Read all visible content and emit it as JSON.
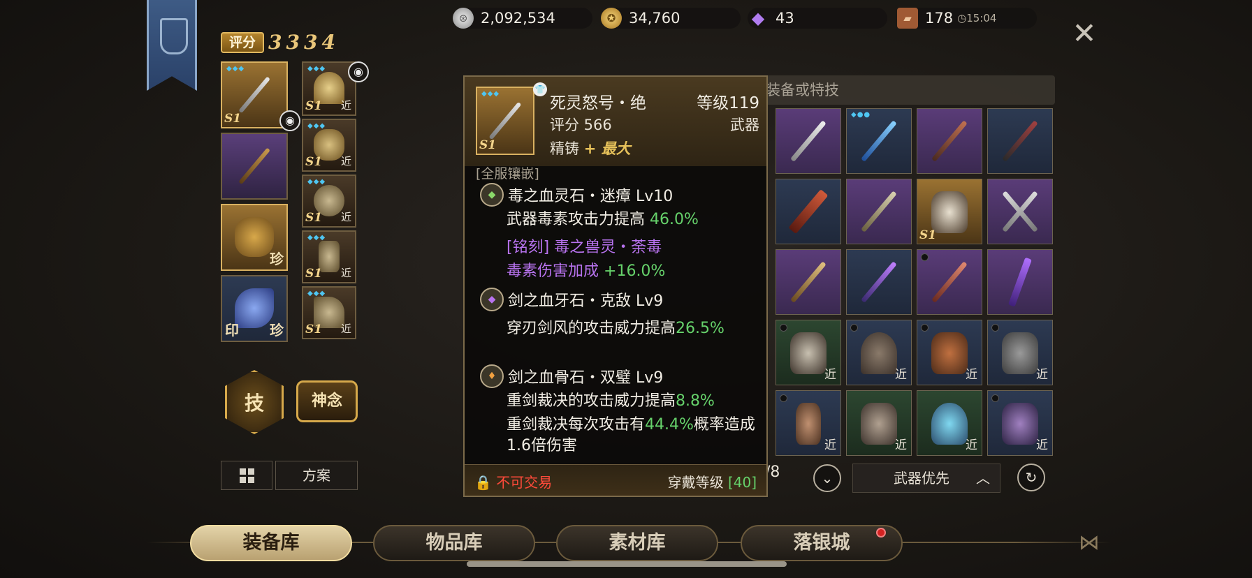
{
  "currencies": [
    {
      "icon": "silver-coin-icon",
      "value": "2,092,534"
    },
    {
      "icon": "gold-coin-icon",
      "value": "34,760"
    },
    {
      "icon": "diamond-icon",
      "value": "43"
    },
    {
      "icon": "ticket-icon",
      "value": "178",
      "timer": "15:04"
    }
  ],
  "score": {
    "label": "评分",
    "value": "3334"
  },
  "equipped": {
    "slot_labels": [
      "珍",
      "印",
      "珍"
    ],
    "tier": "S1",
    "near": "近"
  },
  "buttons": {
    "skill": "技",
    "mind": "神念",
    "plan": "方案"
  },
  "search": {
    "placeholder": "装备或特技"
  },
  "inventory": {
    "near": "近",
    "tier": "S1",
    "pager": "/8",
    "sort": "武器优先"
  },
  "tooltip": {
    "name": "死灵怒号・绝",
    "level": "等级119",
    "score": "评分 566",
    "type": "武器",
    "refine_label": "精铸",
    "refine_value": "+ 最大",
    "section": "[全服镶嵌]",
    "gems": [
      {
        "name": "毒之血灵石・迷瘴 Lv10",
        "effect_text": "武器毒素攻击力提高",
        "effect_value": "46.0%",
        "engrave_title": "[铭刻] 毒之兽灵・荼毒",
        "engrave_text": "毒素伤害加成",
        "engrave_value": "+16.0%"
      },
      {
        "name": "剑之血牙石・克敌 Lv9",
        "effect_text": "穿刃剑风的攻击威力提高",
        "effect_value": "26.5%"
      },
      {
        "name": "剑之血骨石・双璧 Lv9",
        "effect_text": "重剑裁决的攻击威力提高",
        "effect_value": "8.8%",
        "effect2_pre": "重剑裁决每次攻击有",
        "effect2_value": "44.4%",
        "effect2_post": "概率造成1.6倍伤害"
      }
    ],
    "lock_text": "不可交易",
    "wear_label": "穿戴等级",
    "wear_value": "[40]"
  },
  "tabs": [
    "装备库",
    "物品库",
    "素材库",
    "落银城"
  ]
}
